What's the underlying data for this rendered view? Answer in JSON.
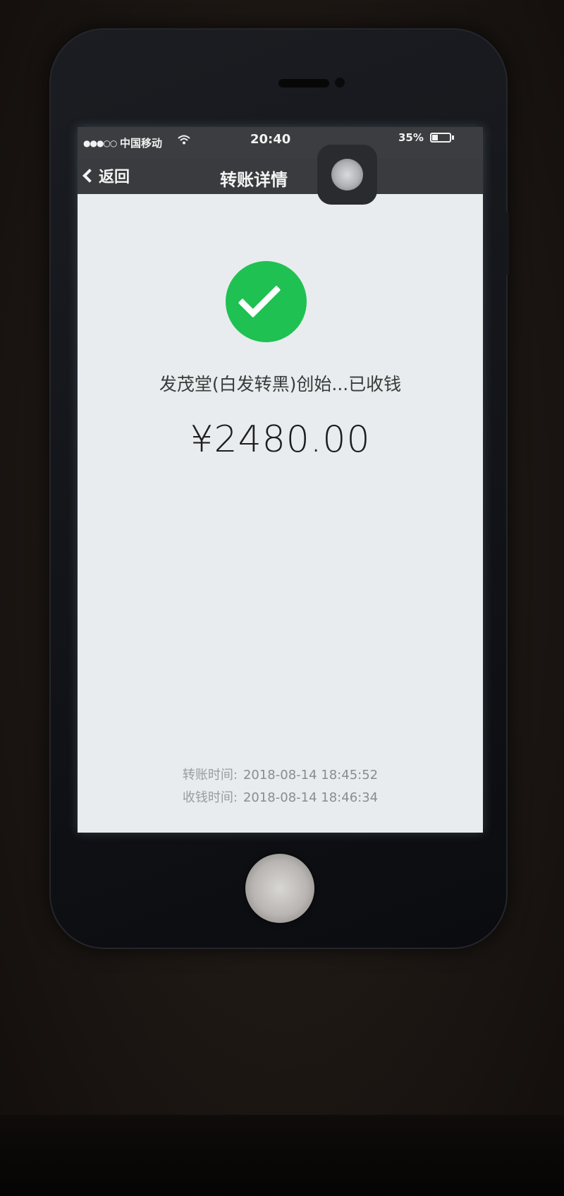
{
  "status_bar": {
    "signal": "●●●○○",
    "carrier": "中国移动",
    "wifi_icon": "wifi-icon",
    "time": "20:40",
    "battery_percent": "35%",
    "battery_level": 0.35
  },
  "nav_bar": {
    "back_label": "返回",
    "title": "转账详情"
  },
  "transfer": {
    "status_icon": "check-circle-icon",
    "payee_status": "发茂堂(白发转黑)创始...已收钱",
    "amount": "¥2480.00",
    "transfer_time_label": "转账时间:",
    "transfer_time": "2018-08-14 18:45:52",
    "receive_time_label": "收钱时间:",
    "receive_time": "2018-08-14 18:46:34"
  },
  "colors": {
    "success_green": "#1fc152",
    "navbar": "#3a3b3e",
    "screen_bg": "#e8ecee"
  }
}
